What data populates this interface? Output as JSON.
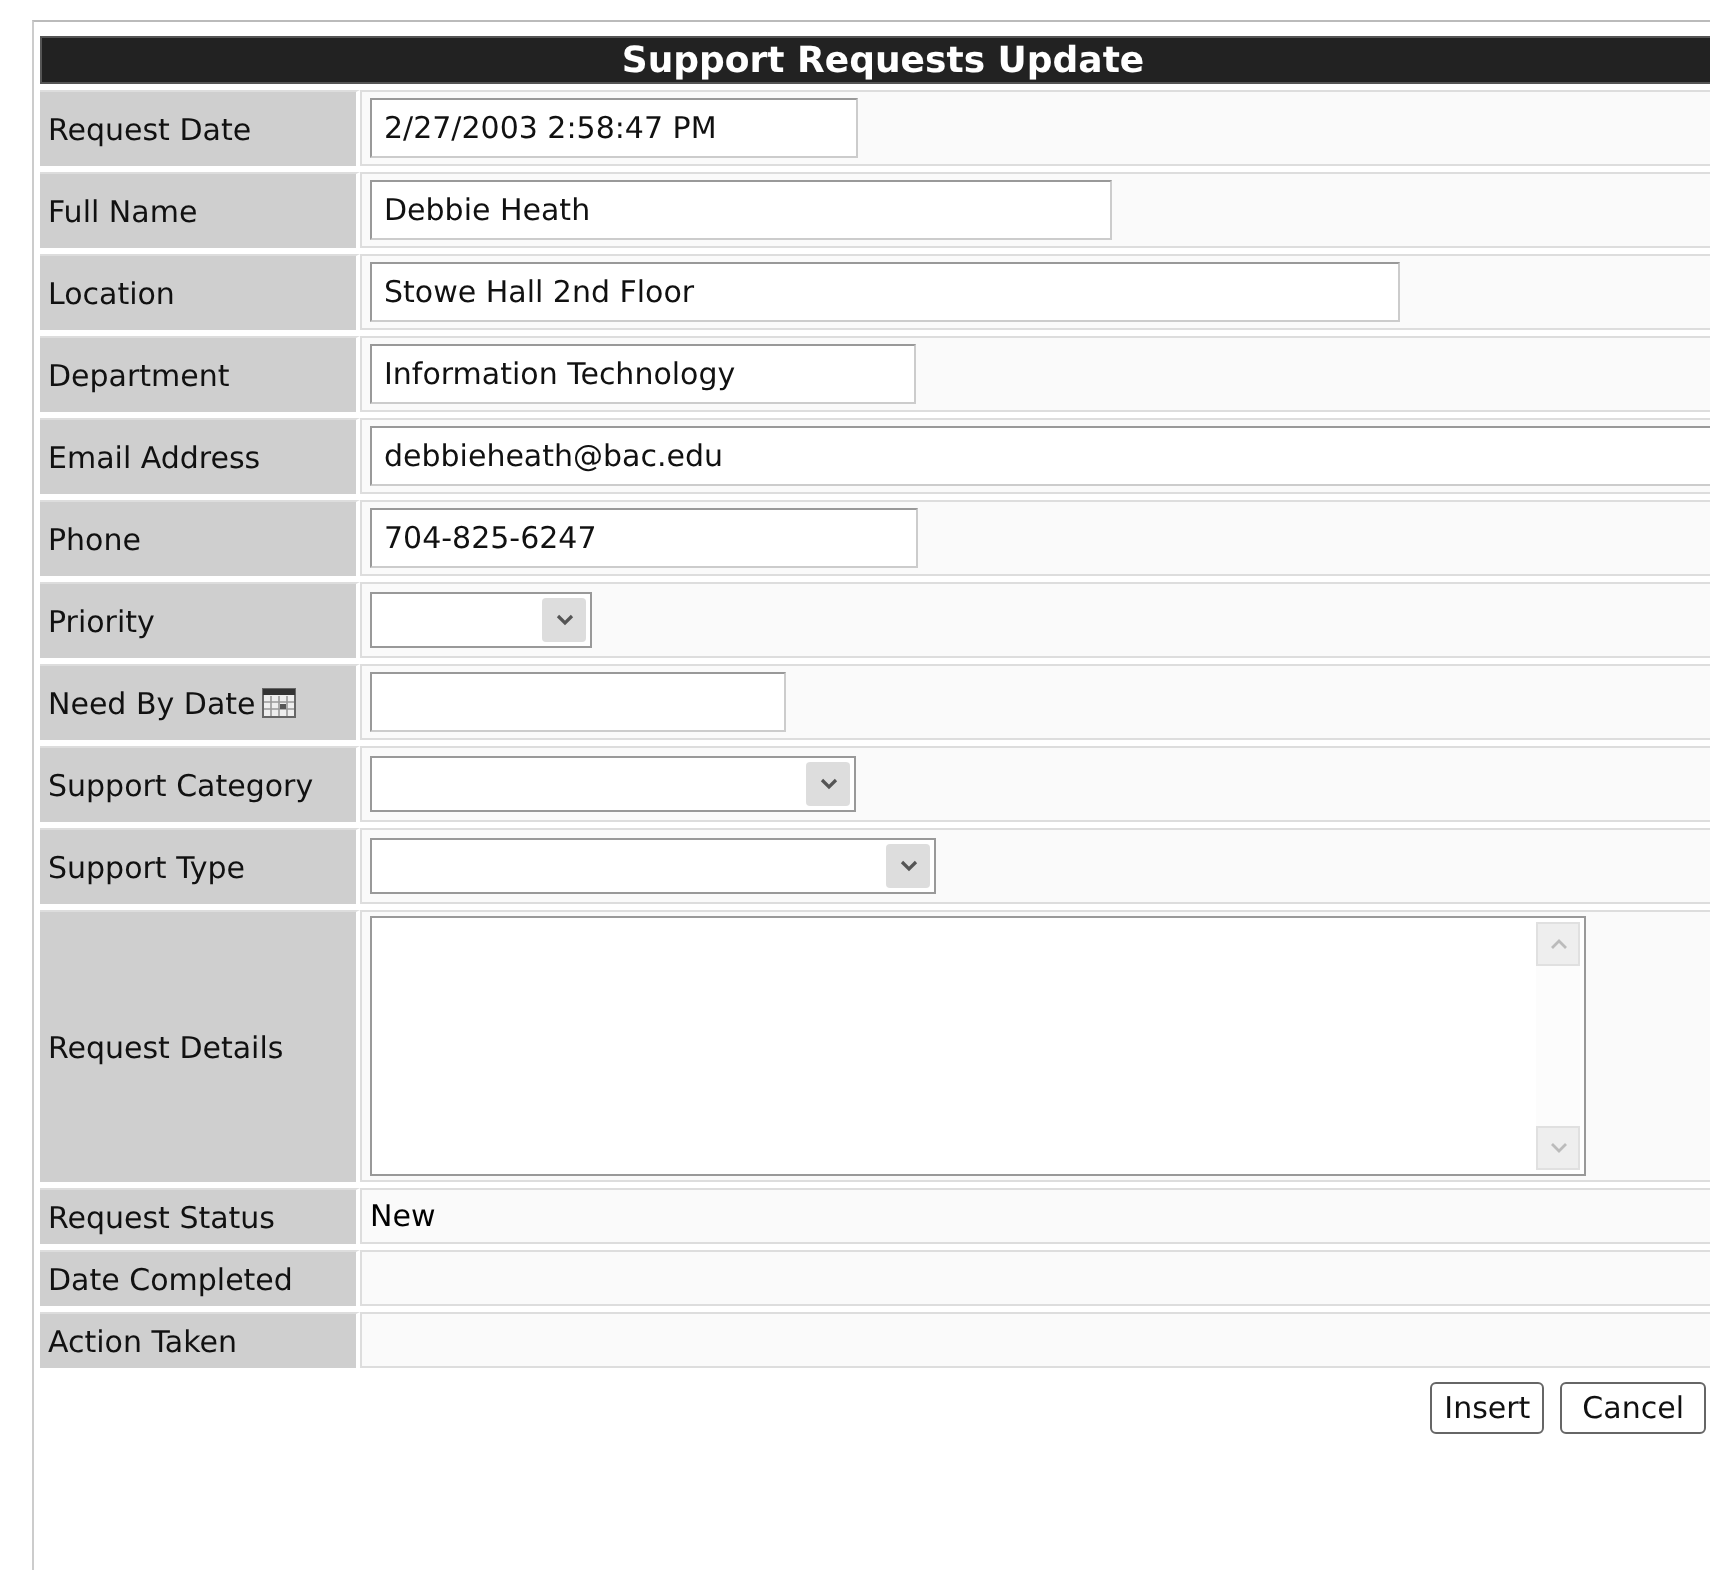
{
  "title": "Support Requests Update",
  "fields": [
    {
      "label": "Request Date",
      "kind": "text",
      "value": "2/27/2003 2:58:47 PM"
    },
    {
      "label": "Full Name",
      "kind": "text",
      "value": "Debbie Heath"
    },
    {
      "label": "Location",
      "kind": "text",
      "value": "Stowe Hall 2nd Floor"
    },
    {
      "label": "Department",
      "kind": "text",
      "value": "Information Technology"
    },
    {
      "label": "Email Address",
      "kind": "text",
      "value": "debbieheath@bac.edu"
    },
    {
      "label": "Phone",
      "kind": "text",
      "value": "704-825-6247"
    },
    {
      "label": "Priority",
      "kind": "select"
    },
    {
      "label": "Need By Date",
      "kind": "date"
    },
    {
      "label": "Support Category",
      "kind": "select"
    },
    {
      "label": "Support Type",
      "kind": "select"
    },
    {
      "label": "Request Details",
      "kind": "textarea"
    },
    {
      "label": "Request Status",
      "kind": "static",
      "value": "New"
    },
    {
      "label": "Date Completed",
      "kind": "static"
    },
    {
      "label": "Action Taken",
      "kind": "static"
    }
  ],
  "buttons": [
    "Insert",
    "Cancel"
  ]
}
